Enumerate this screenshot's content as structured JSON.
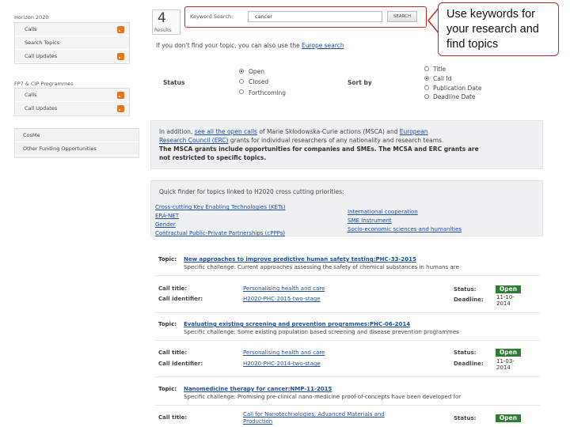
{
  "sidebar": {
    "h2020_title": "Horizon 2020",
    "h2020_items": [
      "Calls",
      "Search Topics",
      "Call Updates"
    ],
    "fp7_title": "FP7 & CIP Programmes",
    "fp7_items": [
      "Calls",
      "Call Updates"
    ],
    "other_items": [
      "CosMe",
      "Other Funding Opportunities"
    ]
  },
  "results": {
    "count": "4",
    "label": "Results"
  },
  "search": {
    "label": "Keyword Search:",
    "value": "cancer",
    "button": "SEARCH"
  },
  "callout": {
    "text": "Use keywords for your research and find topics"
  },
  "europe_note": {
    "prefix": "If you don't find your topic, you can also use the ",
    "link": "Europe search"
  },
  "filters": {
    "status_label": "Status",
    "status_options": [
      "Open",
      "Closed",
      "Forthcoming"
    ],
    "sort_label": "Sort by",
    "sort_options": [
      "Title",
      "Call Id",
      "Publication Date",
      "Deadline Date"
    ]
  },
  "info": {
    "line1_prefix": "In addition, ",
    "line1_link": "see all the open calls",
    "line1_mid": " of Marie Skłodowska-Curie actions (MSCA) and ",
    "line1_link2": "European",
    "line2_link": "Research Council (ERC)",
    "line2_rest": " grants for individual researchers of any nationality and research teams.",
    "line3": "The MSCA grants include opportunities for companies and SMEs. The MCSA and ERC grants are",
    "line4": "not restricted to specific topics."
  },
  "quickfinder": {
    "title": "Quick finder for topics linked to H2020 cross cutting priorities:",
    "left": [
      "Cross-cutting Key Enabling Technologies (KETs)",
      "ERA-NET",
      "Gender",
      "Contractual Public-Private Partnerships (cPPPs)"
    ],
    "right": [
      "International cooperation",
      "SME Instrument",
      "Socio-economic sciences and humanities"
    ]
  },
  "topics": [
    {
      "topic_label": "Topic:",
      "title": "New approaches to improve predictive human safety testing:PHC-33-2015",
      "challenge": "Specific challenge: Current approaches assessing the safety of chemical substances in humans are",
      "call_title_label": "Call title:",
      "call_title": "Personalising health and care",
      "call_id_label": "Call identifier:",
      "call_id": "H2020-PHC-2015-two-stage",
      "status_label": "Status:",
      "status": "Open",
      "deadline_label": "Deadline:",
      "deadline_1": "11-10-",
      "deadline_2": "2014"
    },
    {
      "topic_label": "Topic:",
      "title": "Evaluating existing screening and prevention programmes:PHC-06-2014",
      "challenge": "Specific challenge: Some existing population based screening and disease prevention programmes",
      "call_title_label": "Call title:",
      "call_title": "Personalising health and care",
      "call_id_label": "Call identifier:",
      "call_id": "H2020-PHC-2014-two-stage",
      "status_label": "Status:",
      "status": "Open",
      "deadline_label": "Deadline:",
      "deadline_1": "11-03-",
      "deadline_2": "2014"
    },
    {
      "topic_label": "Topic:",
      "title": "Nanomedicine therapy for cancer:NMP-11-2015",
      "challenge": "Specific challenge: Promising pre-clinical nano-medicine proof-of-concepts have been developed for",
      "call_title_label": "Call title:",
      "call_title_1": "Call for Nanotechnologies, Advanced Materials and",
      "call_title_2": "Production",
      "status_label": "Status:",
      "status": "Open"
    }
  ]
}
